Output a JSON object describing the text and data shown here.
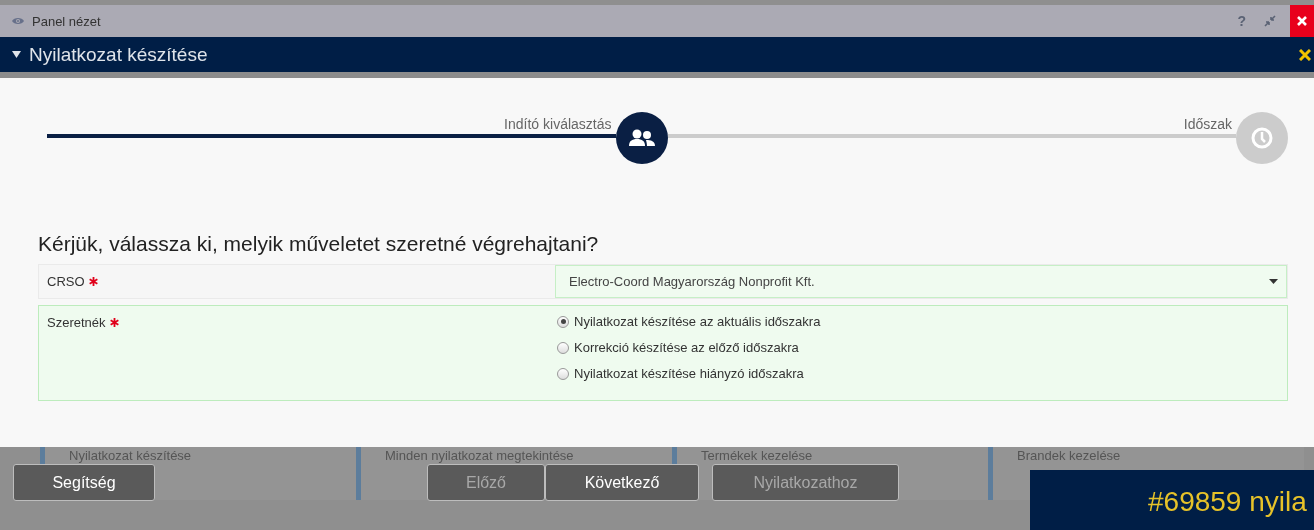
{
  "top_bar": {
    "title": "Panel nézet",
    "help": "?"
  },
  "panel": {
    "title": "Nyilatkozat készítése"
  },
  "steps": [
    {
      "label": "Indító kiválasztás",
      "selected": true
    },
    {
      "label": "Időszak",
      "selected": false
    }
  ],
  "question": "Kérjük, válassza ki, melyik műveletet szeretné végrehajtani?",
  "fields": [
    {
      "kind": "select",
      "label": "CRSO",
      "required": true,
      "value": "Electro-Coord Magyarország Nonprofit Kft."
    },
    {
      "kind": "radio",
      "label": "Szeretnék",
      "required": true,
      "options": [
        {
          "label": "Nyilatkozat készítése az aktuális időszakra",
          "selected": true
        },
        {
          "label": "Korrekció készítése az előző időszakra",
          "selected": false
        },
        {
          "label": "Nyilatkozat készítése hiányzó időszakra",
          "selected": false
        }
      ]
    }
  ],
  "background_tiles": [
    "Nyilatkozat készítése",
    "Minden nyilatkozat megtekintése",
    "Termékek kezelése",
    "Brandek kezelése"
  ],
  "buttons": [
    {
      "label": "Segítség",
      "disabled": false
    },
    {
      "label": "Előző",
      "disabled": true
    },
    {
      "label": "Következő",
      "disabled": false
    },
    {
      "label": "Nyilatkozathoz",
      "disabled": true
    }
  ],
  "notice": "#69859 nyila"
}
